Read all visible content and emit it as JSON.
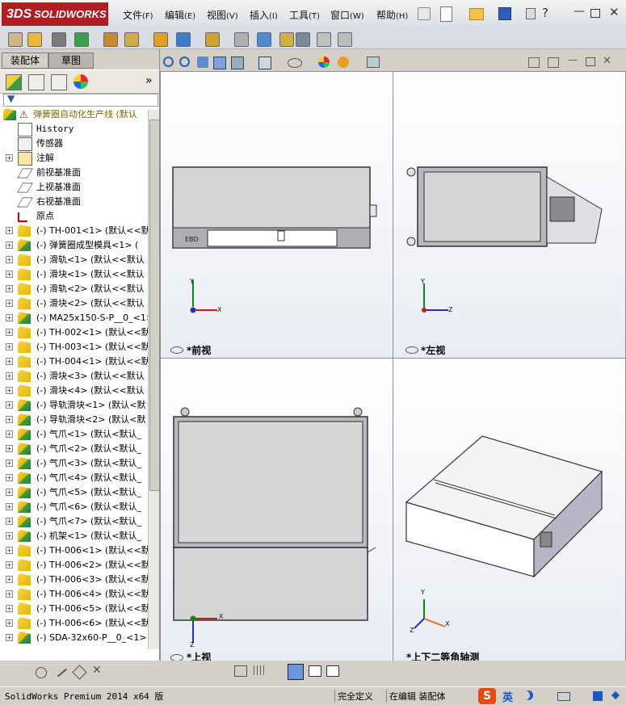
{
  "app": {
    "logo": "SOLIDWORKS",
    "logo_prefix": "3DS"
  },
  "menu": [
    {
      "label": "文件",
      "key": "(F)"
    },
    {
      "label": "编辑",
      "key": "(E)"
    },
    {
      "label": "视图",
      "key": "(V)"
    },
    {
      "label": "插入",
      "key": "(I)"
    },
    {
      "label": "工具",
      "key": "(T)"
    },
    {
      "label": "窗口",
      "key": "(W)"
    },
    {
      "label": "帮助",
      "key": "(H)"
    }
  ],
  "tabs": {
    "assembly": "装配体",
    "sketch": "草图"
  },
  "tree": {
    "root": "弹簧圈自动化生产线  (默认",
    "items": [
      {
        "label": "History",
        "icon": "history-icon",
        "mono": true
      },
      {
        "label": "传感器",
        "icon": "sensor-icon"
      },
      {
        "label": "注解",
        "icon": "annotation-icon",
        "expand": true
      },
      {
        "label": "前视基准面",
        "icon": "plane-icon"
      },
      {
        "label": "上视基准面",
        "icon": "plane-icon"
      },
      {
        "label": "右视基准面",
        "icon": "plane-icon"
      },
      {
        "label": "原点",
        "icon": "origin-icon"
      },
      {
        "label": "(-) TH-001<1> (默认<<默",
        "icon": "component-icon",
        "expand": true
      },
      {
        "label": "(-) 弹簧圈成型模具<1> (",
        "icon": "subassembly-icon",
        "expand": true
      },
      {
        "label": "(-) 滑轨<1> (默认<<默认",
        "icon": "component-icon",
        "expand": true
      },
      {
        "label": "(-) 滑块<1> (默认<<默认",
        "icon": "component-icon",
        "expand": true
      },
      {
        "label": "(-) 滑轨<2> (默认<<默认",
        "icon": "component-icon",
        "expand": true
      },
      {
        "label": "(-) 滑块<2> (默认<<默认",
        "icon": "component-icon",
        "expand": true
      },
      {
        "label": "(-) MA25x150-S-P__0_<1>",
        "icon": "subassembly-icon",
        "expand": true
      },
      {
        "label": "(-) TH-002<1> (默认<<默",
        "icon": "component-icon",
        "expand": true
      },
      {
        "label": "(-) TH-003<1> (默认<<默",
        "icon": "component-icon",
        "expand": true
      },
      {
        "label": "(-) TH-004<1> (默认<<默",
        "icon": "component-icon",
        "expand": true
      },
      {
        "label": "(-) 滑块<3> (默认<<默认",
        "icon": "component-icon",
        "expand": true
      },
      {
        "label": "(-) 滑块<4> (默认<<默认",
        "icon": "component-icon",
        "expand": true
      },
      {
        "label": "(-) 导轨滑块<1> (默认<默",
        "icon": "subassembly-icon",
        "expand": true
      },
      {
        "label": "(-) 导轨滑块<2> (默认<默",
        "icon": "subassembly-icon",
        "expand": true
      },
      {
        "label": "(-) 气爪<1> (默认<默认_",
        "icon": "subassembly-icon",
        "expand": true
      },
      {
        "label": "(-) 气爪<2> (默认<默认_",
        "icon": "subassembly-icon",
        "expand": true
      },
      {
        "label": "(-) 气爪<3> (默认<默认_",
        "icon": "subassembly-icon",
        "expand": true
      },
      {
        "label": "(-) 气爪<4> (默认<默认_",
        "icon": "subassembly-icon",
        "expand": true
      },
      {
        "label": "(-) 气爪<5> (默认<默认_",
        "icon": "subassembly-icon",
        "expand": true
      },
      {
        "label": "(-) 气爪<6> (默认<默认_",
        "icon": "subassembly-icon",
        "expand": true
      },
      {
        "label": "(-) 气爪<7> (默认<默认_",
        "icon": "subassembly-icon",
        "expand": true
      },
      {
        "label": "(-) 机架<1> (默认<默认_",
        "icon": "subassembly-icon",
        "expand": true
      },
      {
        "label": "(-) TH-006<1> (默认<<默",
        "icon": "component-icon",
        "expand": true
      },
      {
        "label": "(-) TH-006<2> (默认<<默",
        "icon": "component-icon",
        "expand": true
      },
      {
        "label": "(-) TH-006<3> (默认<<默",
        "icon": "component-icon",
        "expand": true
      },
      {
        "label": "(-) TH-006<4> (默认<<默",
        "icon": "component-icon",
        "expand": true
      },
      {
        "label": "(-) TH-006<5> (默认<<默",
        "icon": "component-icon",
        "expand": true
      },
      {
        "label": "(-) TH-006<6> (默认<<默",
        "icon": "component-icon",
        "expand": true
      },
      {
        "label": "(-) SDA-32x60-P__0_<1>",
        "icon": "subassembly-icon",
        "expand": true
      }
    ]
  },
  "viewports": {
    "front": "*前视",
    "left": "*左视",
    "top": "*上视",
    "iso": "*上下二等角轴测"
  },
  "axes": {
    "x": "X",
    "y": "Y",
    "z": "Z"
  },
  "status": {
    "version": "SolidWorks Premium 2014 x64 版",
    "defined": "完全定义",
    "editing": "在编辑 装配体",
    "ime": "英"
  },
  "colors": {
    "brand": "#b01e23",
    "model": "#d6d6d8",
    "model_dark": "#8a8a8f"
  }
}
